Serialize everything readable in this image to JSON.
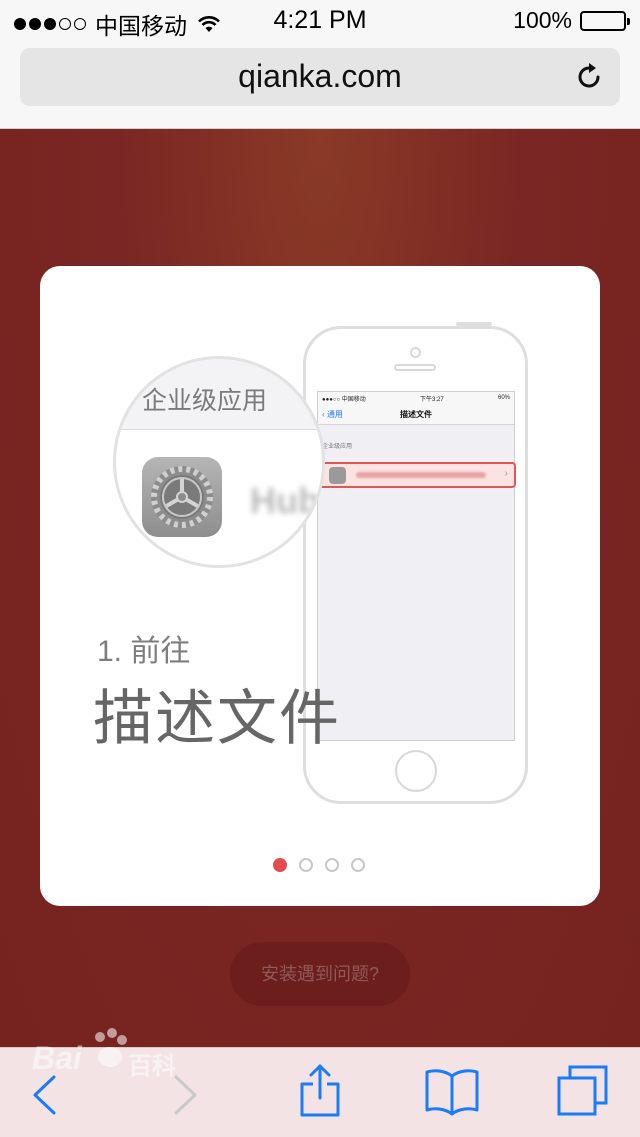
{
  "status_bar": {
    "carrier": "中国移动",
    "time": "4:21 PM",
    "battery": "100%"
  },
  "browser": {
    "url": "qianka.com"
  },
  "card": {
    "magnifier_title": "企业级应用",
    "magnifier_blurred_text": "Hube",
    "step_number": "1. 前往",
    "step_title": "描述文件",
    "phone": {
      "carrier": "●●●○○ 中国移动",
      "time": "下午3:27",
      "battery": "60%",
      "back_label": "通用",
      "title": "描述文件",
      "section": "企业级应用"
    },
    "pagination": {
      "total": 4,
      "active": 0
    }
  },
  "help_button": "安装遇到问题?",
  "watermark": {
    "logo_text": "Bai",
    "logo_suffix": "百科"
  },
  "colors": {
    "background": "#7a2422",
    "accent_dot": "#e44b4f",
    "ios_blue": "#1a7cf6"
  },
  "toolbar": {
    "back_icon": "chevron-left-icon",
    "forward_icon": "chevron-right-icon",
    "share_icon": "share-icon",
    "bookmarks_icon": "book-icon",
    "tabs_icon": "tabs-icon"
  }
}
